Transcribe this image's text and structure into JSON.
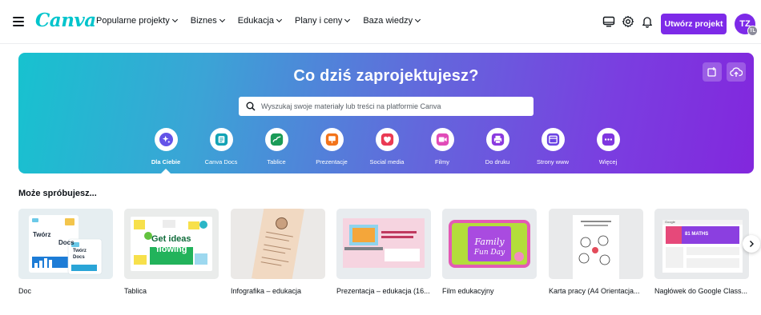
{
  "app": {
    "logo": "Canva"
  },
  "nav": {
    "items": [
      {
        "label": "Popularne projekty"
      },
      {
        "label": "Biznes"
      },
      {
        "label": "Edukacja"
      },
      {
        "label": "Plany i ceny"
      },
      {
        "label": "Baza wiedzy"
      }
    ]
  },
  "header": {
    "create_button": "Utwórz projekt",
    "avatar_initials": "TZ",
    "avatar_badge": "TL",
    "icons": [
      "monitor-icon",
      "gear-icon",
      "bell-icon"
    ]
  },
  "hero": {
    "title": "Co dziś zaprojektujesz?",
    "search_placeholder": "Wyszukaj swoje materiały lub treści na platformie Canva",
    "categories": [
      {
        "label": "Dla Ciebie",
        "icon": "sparkle-icon",
        "color": "#6453e8",
        "active": true
      },
      {
        "label": "Canva Docs",
        "icon": "doc-icon",
        "color": "#13a3b5"
      },
      {
        "label": "Tablice",
        "icon": "whiteboard-icon",
        "color": "#1a9b57"
      },
      {
        "label": "Prezentacje",
        "icon": "presentation-icon",
        "color": "#f3741b"
      },
      {
        "label": "Social media",
        "icon": "heart-icon",
        "color": "#ea3a54"
      },
      {
        "label": "Filmy",
        "icon": "video-icon",
        "color": "#e14bb8"
      },
      {
        "label": "Do druku",
        "icon": "print-icon",
        "color": "#8a3ae0"
      },
      {
        "label": "Strony www",
        "icon": "website-icon",
        "color": "#6b44e3"
      },
      {
        "label": "Więcej",
        "icon": "more-icon",
        "color": "#7f36e0"
      }
    ]
  },
  "suggestions": {
    "title": "Może spróbujesz...",
    "cards": [
      {
        "label": "Doc",
        "thumb_text": [
          "Twórz",
          "Docs",
          "Twórz",
          "Docs"
        ]
      },
      {
        "label": "Tablica",
        "thumb_text": [
          "Get ideas",
          "flowing"
        ]
      },
      {
        "label": "Infografika – edukacja"
      },
      {
        "label": "Prezentacja – edukacja (16..."
      },
      {
        "label": "Film edukacyjny",
        "thumb_text": [
          "Family",
          "Fun Day"
        ]
      },
      {
        "label": "Karta pracy (A4 Orientacja..."
      },
      {
        "label": "Nagłówek do Google Class...",
        "thumb_text": [
          "Google",
          "81 MATHS"
        ]
      }
    ]
  },
  "colors": {
    "accent": "#7d2ae8",
    "logo": "#00c4cc"
  }
}
